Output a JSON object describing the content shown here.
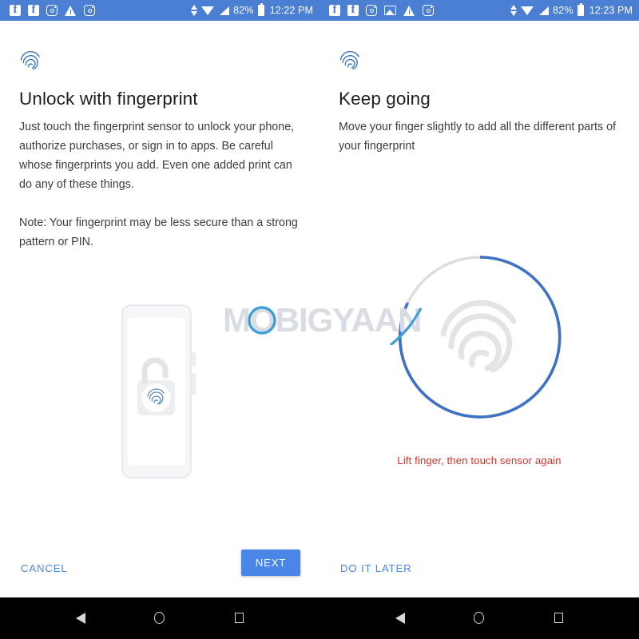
{
  "statusbars": [
    {
      "id": "left",
      "notification_icons": [
        "facebook-icon",
        "facebook-icon",
        "instagram-icon",
        "warning-icon",
        "instagram-icon"
      ],
      "sync_icon": "sync-icon",
      "wifi_icon": "wifi-icon",
      "signal_icon": "signal-icon",
      "battery_percent": "82%",
      "battery_icon": "battery-icon",
      "time": "12:22 PM",
      "background_color": "#4a7fd4"
    },
    {
      "id": "right",
      "notification_icons": [
        "facebook-icon",
        "facebook-icon",
        "instagram-icon",
        "photo-icon",
        "warning-icon",
        "instagram-icon"
      ],
      "sync_icon": "sync-icon",
      "wifi_icon": "wifi-icon",
      "signal_icon": "signal-icon",
      "battery_percent": "82%",
      "battery_icon": "battery-icon",
      "time": "12:23 PM",
      "background_color": "#4a7fd4"
    }
  ],
  "panels": {
    "left": {
      "header_icon": "fingerprint-icon",
      "title": "Unlock with fingerprint",
      "body": "Just touch the fingerprint sensor to unlock your phone, authorize purchases, or sign in to apps. Be careful whose fingerprints you add. Even one added print can do any of these things.",
      "note": "Note: Your fingerprint may be less secure than a strong pattern or PIN.",
      "illustration": "phone-with-unlocked-fingerprint-lock"
    },
    "right": {
      "header_icon": "fingerprint-icon",
      "title": "Keep going",
      "body": "Move your finger slightly to add all the different parts of your fingerprint",
      "illustration": "fingerprint-enrollment-progress-ring",
      "progress_percent": 82,
      "progress_color": "#3f72c4",
      "progress_track_color": "#dddddd",
      "status_message": "Lift finger, then touch sensor again",
      "status_message_color": "#d0342c"
    }
  },
  "footer": {
    "cancel_label": "CANCEL",
    "next_label": "NEXT",
    "do_it_later_label": "DO IT LATER",
    "accent_color": "#4a86e8"
  },
  "navbars": [
    {
      "back": "back-icon",
      "home": "home-icon",
      "recents": "recents-icon"
    },
    {
      "back": "back-icon",
      "home": "home-icon",
      "recents": "recents-icon"
    }
  ],
  "watermark": {
    "text": "MOBIGYAAN",
    "color": "#d9dde3",
    "accent_color": "#3d9fd6"
  }
}
